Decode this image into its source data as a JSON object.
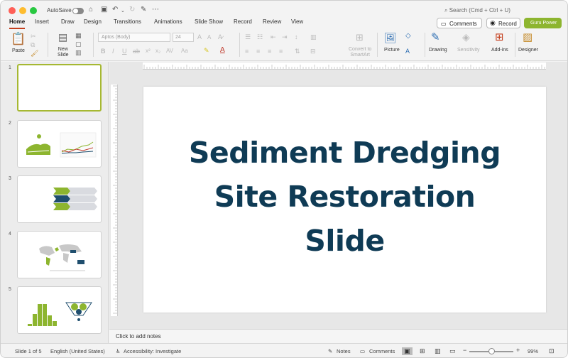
{
  "titlebar": {
    "autosave_label": "AutoSave",
    "search_placeholder": "Search (Cmd + Ctrl + U)"
  },
  "tabs": [
    "Home",
    "Insert",
    "Draw",
    "Design",
    "Transitions",
    "Animations",
    "Slide Show",
    "Record",
    "Review",
    "View"
  ],
  "actions": {
    "comments_label": "Comments",
    "record_label": "Record",
    "guru_label": "Guru Power"
  },
  "ribbon": {
    "paste_label": "Paste",
    "new_slide_label": "New\nSlide",
    "font_name": "Aptos (Body)",
    "font_size": "24",
    "convert_label": "Convert to\nSmartArt",
    "picture_label": "Picture",
    "drawing_label": "Drawing",
    "sensitivity_label": "Sensitivity",
    "addins_label": "Add-ins",
    "designer_label": "Designer"
  },
  "slides": [
    {
      "number": "1"
    },
    {
      "number": "2"
    },
    {
      "number": "3"
    },
    {
      "number": "4"
    },
    {
      "number": "5"
    }
  ],
  "current_slide": {
    "title_lines": [
      "Sediment Dredging",
      "Site Restoration",
      "Slide"
    ],
    "title_color": "#0f3b55"
  },
  "notes": {
    "placeholder": "Click to add notes"
  },
  "statusbar": {
    "slide_position": "Slide 1 of 5",
    "language": "English (United States)",
    "accessibility": "Accessibility: Investigate",
    "notes_label": "Notes",
    "comments_label": "Comments",
    "zoom": "99%"
  },
  "colors": {
    "accent": "#c43e1c",
    "guru": "#8db52f",
    "selected_thumb": "#a6b832",
    "chart_green": "#8db52f",
    "chart_navy": "#1f4e6e"
  }
}
